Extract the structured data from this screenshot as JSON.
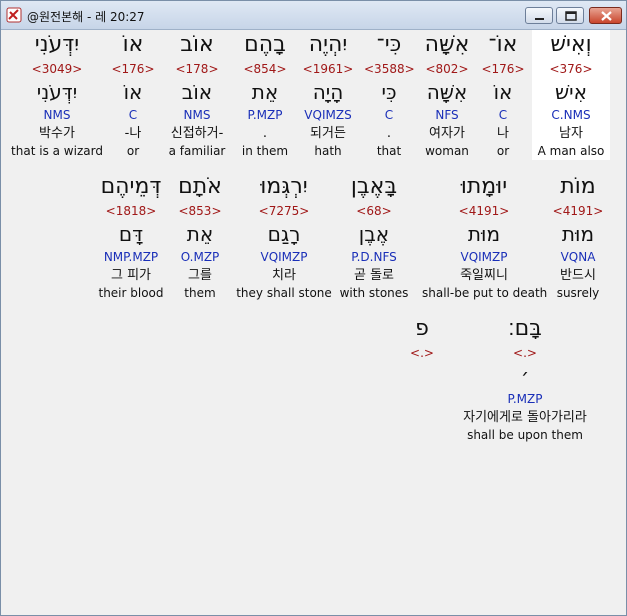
{
  "window": {
    "title": "@원전본해 - 레 20:27",
    "min_icon": "minimize-icon",
    "max_icon": "maximize-icon",
    "close_icon": "close-icon"
  },
  "rows": [
    [
      {
        "heb": "וְאִישׁ",
        "strong": "<376>",
        "lemma": "אִישׁ",
        "morph": "C.NMS",
        "kor": "남자",
        "eng": "A man also",
        "selected": true
      },
      {
        "heb": "אוֹ־",
        "strong": "<176>",
        "lemma": "אוֹ",
        "morph": "C",
        "kor": "나",
        "eng": "or"
      },
      {
        "heb": "אִשָּׁה",
        "strong": "<802>",
        "lemma": "אִשָּׁה",
        "morph": "NFS",
        "kor": "여자가",
        "eng": "woman"
      },
      {
        "heb": "כִּי־",
        "strong": "<3588>",
        "lemma": "כִּי",
        "morph": "C",
        "kor": ".",
        "eng": "that"
      },
      {
        "heb": "יִהְיֶה",
        "strong": "<1961>",
        "lemma": "הָיָה",
        "morph": "VQIMZS",
        "kor": "되거든",
        "eng": "hath"
      },
      {
        "heb": "בָהֶם",
        "strong": "<854>",
        "lemma": "אֵת",
        "morph": "P.MZP",
        "kor": ".",
        "eng": "in them"
      },
      {
        "heb": "אוֹב",
        "strong": "<178>",
        "lemma": "אוֹב",
        "morph": "NMS",
        "kor": "신접하거-",
        "eng": "a familiar"
      },
      {
        "heb": "אוֹ",
        "strong": "<176>",
        "lemma": "אוֹ",
        "morph": "C",
        "kor": "-나",
        "eng": "or"
      },
      {
        "heb": "יִדְּעֹנִי",
        "strong": "<3049>",
        "lemma": "יִדְּעֹנִי",
        "morph": "NMS",
        "kor": "박수가",
        "eng": "that is a wizard"
      }
    ],
    [
      {
        "heb": "מוֹת",
        "strong": "<4191>",
        "lemma": "מוּת",
        "morph": "VQNA",
        "kor": "반드시",
        "eng": "susrely"
      },
      {
        "heb": "יוּמָתוּ",
        "strong": "<4191>",
        "lemma": "מוּת",
        "morph": "VQIMZP",
        "kor": "죽일찌니",
        "eng": "shall-be put to death"
      },
      {
        "heb": "בָּאֶבֶן",
        "strong": "<68>",
        "lemma": "אֶבֶן",
        "morph": "P.D.NFS",
        "kor": "곧 돌로",
        "eng": "with stones"
      },
      {
        "heb": "יִרְגְּמוּ",
        "strong": "<7275>",
        "lemma": "רָגַם",
        "morph": "VQIMZP",
        "kor": "치라",
        "eng": "they shall stone"
      },
      {
        "heb": "אֹתָם",
        "strong": "<853>",
        "lemma": "אֵת",
        "morph": "O.MZP",
        "kor": "그를",
        "eng": "them"
      },
      {
        "heb": "דְּמֵיהֶם",
        "strong": "<1818>",
        "lemma": "דָּם",
        "morph": "NMP.MZP",
        "kor": "그 피가",
        "eng": "their blood"
      }
    ],
    [
      {
        "heb": "בָּם׃",
        "strong": "<.>",
        "lemma": "׳",
        "morph": "P.MZP",
        "kor": "자기에게로 돌아가리라",
        "eng": "shall be upon them"
      },
      {
        "heb": "פ",
        "strong": "<.>",
        "lemma": "",
        "morph": "",
        "kor": "",
        "eng": ""
      }
    ]
  ]
}
